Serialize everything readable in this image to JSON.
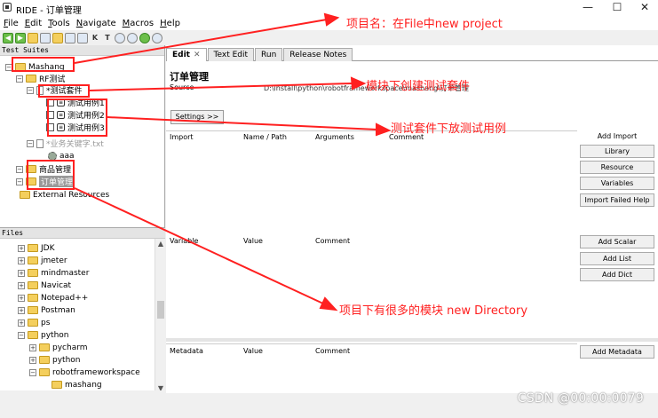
{
  "window": {
    "title": "RIDE - 订单管理",
    "min": "—",
    "max": "☐",
    "close": "✕"
  },
  "menu": [
    {
      "key": "F",
      "rest": "ile"
    },
    {
      "key": "E",
      "rest": "dit"
    },
    {
      "key": "T",
      "rest": "ools"
    },
    {
      "key": "N",
      "rest": "avigate"
    },
    {
      "key": "M",
      "rest": "acros"
    },
    {
      "key": "H",
      "rest": "elp"
    }
  ],
  "toolbar": {
    "k": "K",
    "t": "T"
  },
  "tree": {
    "header": "Test Suites",
    "project": "Mashang",
    "rf_dir": "RF测试",
    "suite": "*测试套件",
    "cases": [
      "测试用例1",
      "测试用例2",
      "测试用例3"
    ],
    "keyword_file": "*业务关键字.txt",
    "keyword": "aaa",
    "module1": "商品管理",
    "module2": "订单管理",
    "external": "External Resources"
  },
  "files": {
    "header": "Files",
    "items": [
      "JDK",
      "jmeter",
      "mindmaster",
      "Navicat",
      "Notepad++",
      "Postman",
      "ps",
      "python",
      "pycharm",
      "python",
      "robotframeworkspace",
      "mashang"
    ]
  },
  "editor": {
    "tabs": [
      "Edit",
      "Text Edit",
      "Run",
      "Release Notes"
    ],
    "tab_close": "✕",
    "title": "订单管理",
    "source_label": "Source",
    "source_path": "D:\\install\\python\\robotframeworkspace\\mashang\\订单管理",
    "settings_button": "Settings >>",
    "import_headers": [
      "Import",
      "Name / Path",
      "Arguments",
      "Comment"
    ],
    "variable_headers": [
      "Variable",
      "Value",
      "Comment"
    ],
    "metadata_headers": [
      "Metadata",
      "Value",
      "Comment"
    ],
    "import_buttons": [
      "Add Import",
      "Library",
      "Resource",
      "Variables",
      "Import Failed Help"
    ],
    "variable_buttons": [
      "Add Scalar",
      "Add List",
      "Add Dict"
    ],
    "metadata_button": "Add Metadata"
  },
  "annotations": {
    "project_name": "项目名：在File中new project",
    "create_suite": "模块下创建测试套件",
    "put_cases": "测试套件下放测试用例",
    "modules": "项目下有很多的模块 new Directory",
    "color": "#ff2020"
  },
  "watermark": "CSDN @00:00:0079"
}
